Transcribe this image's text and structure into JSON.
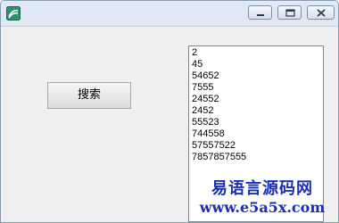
{
  "titlebar": {
    "icon": "app-icon",
    "buttons": [
      "minimize-icon",
      "maximize-icon",
      "close-icon"
    ]
  },
  "main": {
    "search_button_label": "搜索",
    "list_items": [
      "2",
      "45",
      "54652",
      "7555",
      "24552",
      "2452",
      "55523",
      "744558",
      "57557522",
      "7857857555"
    ]
  },
  "watermark": {
    "line1": "易语言源码网",
    "line2": "www.e5a5x.com",
    "color": "#1a2fb8"
  }
}
